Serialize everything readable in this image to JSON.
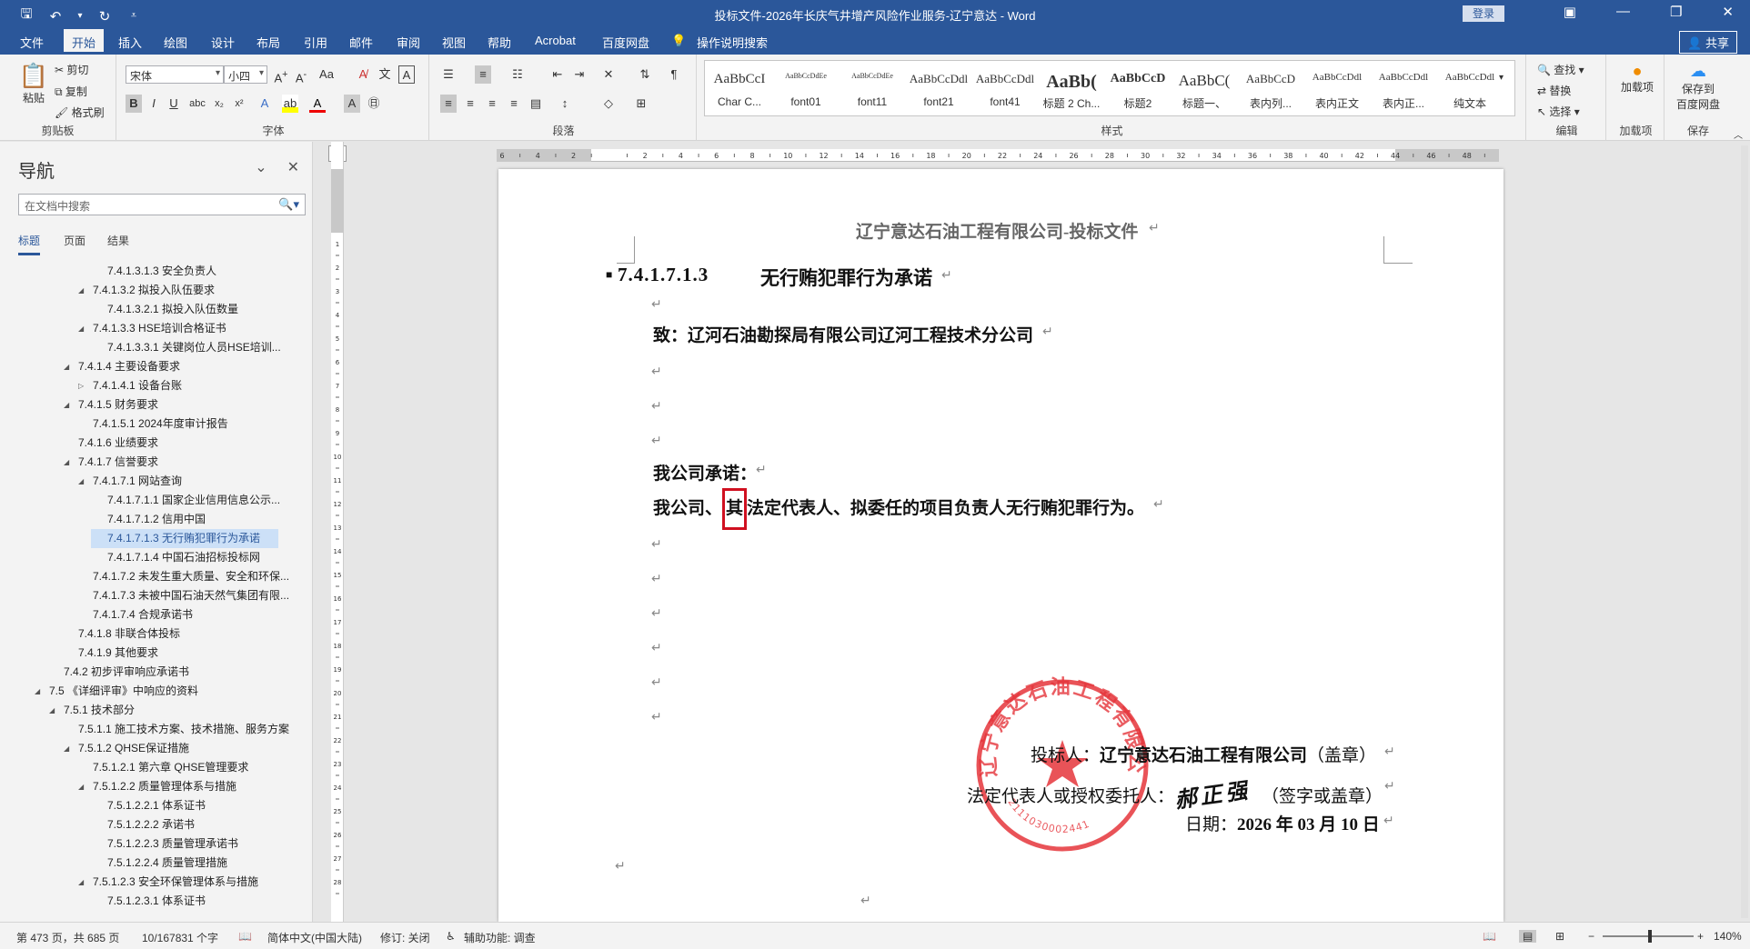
{
  "titlebar": {
    "title": "投标文件-2026年长庆气井增产风险作业服务-辽宁意达 - Word",
    "login": "登录",
    "save_icon": "save-icon",
    "undo_icon": "undo-icon",
    "redo_icon": "redo-icon"
  },
  "tabs": {
    "file": "文件",
    "home": "开始",
    "insert": "插入",
    "draw": "绘图",
    "design": "设计",
    "layout": "布局",
    "references": "引用",
    "mailings": "邮件",
    "review": "审阅",
    "view": "视图",
    "help": "帮助",
    "acrobat": "Acrobat",
    "baidu": "百度网盘",
    "tellme": "操作说明搜索",
    "share": "共享"
  },
  "ribbon": {
    "clipboard": {
      "paste": "粘贴",
      "cut": "剪切",
      "copy": "复制",
      "format_painter": "格式刷",
      "label": "剪贴板"
    },
    "font": {
      "name": "宋体",
      "size": "小四",
      "label": "字体"
    },
    "paragraph": {
      "label": "段落"
    },
    "styles": {
      "label": "样式",
      "items": [
        {
          "sample": "AaBbCcI",
          "name": "Char C..."
        },
        {
          "sample": "AaBbCcDdEe",
          "name": "font01"
        },
        {
          "sample": "AaBbCcDdEe",
          "name": "font11"
        },
        {
          "sample": "AaBbCcDdl",
          "name": "font21"
        },
        {
          "sample": "AaBbCcDdl",
          "name": "font41"
        },
        {
          "sample": "AaBb(",
          "name": "标题 2 Ch..."
        },
        {
          "sample": "AaBbCcD",
          "name": "标题2"
        },
        {
          "sample": "AaBbC(",
          "name": "标题一、"
        },
        {
          "sample": "AaBbCcD",
          "name": "表内列..."
        },
        {
          "sample": "AaBbCcDdl",
          "name": "表内正文"
        },
        {
          "sample": "AaBbCcDdl",
          "name": "表内正..."
        },
        {
          "sample": "AaBbCcDdl",
          "name": "纯文本"
        }
      ]
    },
    "editing": {
      "find": "查找",
      "replace": "替换",
      "select": "选择",
      "label": "编辑"
    },
    "addins": {
      "add": "加载项",
      "label": "加载项"
    },
    "save_baidu": {
      "label1": "保存到",
      "label2": "百度网盘",
      "label": "保存"
    }
  },
  "nav": {
    "title": "导航",
    "search_placeholder": "在文档中搜索",
    "tabs": [
      "标题",
      "页面",
      "结果"
    ],
    "items": [
      {
        "text": "7.4.1.3.1.3 安全负责人",
        "level": 4,
        "arrow": ""
      },
      {
        "text": "7.4.1.3.2 拟投入队伍要求",
        "level": 3,
        "arrow": "◢"
      },
      {
        "text": "7.4.1.3.2.1 拟投入队伍数量",
        "level": 4,
        "arrow": ""
      },
      {
        "text": "7.4.1.3.3 HSE培训合格证书",
        "level": 3,
        "arrow": "◢"
      },
      {
        "text": "7.4.1.3.3.1 关键岗位人员HSE培训...",
        "level": 4,
        "arrow": ""
      },
      {
        "text": "7.4.1.4 主要设备要求",
        "level": 2,
        "arrow": "◢"
      },
      {
        "text": "7.4.1.4.1 设备台账",
        "level": 3,
        "arrow": "▷"
      },
      {
        "text": "7.4.1.5 财务要求",
        "level": 2,
        "arrow": "◢"
      },
      {
        "text": "7.4.1.5.1 2024年度审计报告",
        "level": 3,
        "arrow": ""
      },
      {
        "text": "7.4.1.6 业绩要求",
        "level": 2,
        "arrow": ""
      },
      {
        "text": "7.4.1.7 信誉要求",
        "level": 2,
        "arrow": "◢"
      },
      {
        "text": "7.4.1.7.1 网站查询",
        "level": 3,
        "arrow": "◢"
      },
      {
        "text": "7.4.1.7.1.1 国家企业信用信息公示...",
        "level": 4,
        "arrow": ""
      },
      {
        "text": "7.4.1.7.1.2 信用中国",
        "level": 4,
        "arrow": ""
      },
      {
        "text": "7.4.1.7.1.3 无行贿犯罪行为承诺",
        "level": 4,
        "arrow": "",
        "selected": true
      },
      {
        "text": "7.4.1.7.1.4 中国石油招标投标网",
        "level": 4,
        "arrow": ""
      },
      {
        "text": "7.4.1.7.2 未发生重大质量、安全和环保...",
        "level": 3,
        "arrow": ""
      },
      {
        "text": "7.4.1.7.3 未被中国石油天然气集团有限...",
        "level": 3,
        "arrow": ""
      },
      {
        "text": "7.4.1.7.4 合规承诺书",
        "level": 3,
        "arrow": ""
      },
      {
        "text": "7.4.1.8 非联合体投标",
        "level": 2,
        "arrow": ""
      },
      {
        "text": "7.4.1.9 其他要求",
        "level": 2,
        "arrow": ""
      },
      {
        "text": "7.4.2 初步评审响应承诺书",
        "level": 1,
        "arrow": ""
      },
      {
        "text": "7.5 《详细评审》中响应的资料",
        "level": 0,
        "arrow": "◢"
      },
      {
        "text": "7.5.1 技术部分",
        "level": 1,
        "arrow": "◢"
      },
      {
        "text": "7.5.1.1 施工技术方案、技术措施、服务方案",
        "level": 2,
        "arrow": ""
      },
      {
        "text": "7.5.1.2 QHSE保证措施",
        "level": 2,
        "arrow": "◢"
      },
      {
        "text": "7.5.1.2.1 第六章 QHSE管理要求",
        "level": 3,
        "arrow": ""
      },
      {
        "text": "7.5.1.2.2 质量管理体系与措施",
        "level": 3,
        "arrow": "◢"
      },
      {
        "text": "7.5.1.2.2.1 体系证书",
        "level": 4,
        "arrow": ""
      },
      {
        "text": "7.5.1.2.2.2 承诺书",
        "level": 4,
        "arrow": ""
      },
      {
        "text": "7.5.1.2.2.3 质量管理承诺书",
        "level": 4,
        "arrow": ""
      },
      {
        "text": "7.5.1.2.2.4 质量管理措施",
        "level": 4,
        "arrow": ""
      },
      {
        "text": "7.5.1.2.3 安全环保管理体系与措施",
        "level": 3,
        "arrow": "◢"
      },
      {
        "text": "7.5.1.2.3.1 体系证书",
        "level": 4,
        "arrow": ""
      }
    ]
  },
  "ruler_labels": [
    "6",
    "4",
    "2",
    "",
    "2",
    "4",
    "6",
    "8",
    "10",
    "12",
    "14",
    "16",
    "18",
    "20",
    "22",
    "24",
    "26",
    "28",
    "30",
    "32",
    "34",
    "36",
    "38",
    "40",
    "42",
    "44",
    "46",
    "48"
  ],
  "vruler_labels": [
    "1",
    "2",
    "3",
    "4",
    "5",
    "6",
    "7",
    "8",
    "9",
    "10",
    "11",
    "12",
    "13",
    "14",
    "15",
    "16",
    "17",
    "18",
    "19",
    "20",
    "21",
    "22",
    "23",
    "24",
    "25",
    "26",
    "27",
    "28"
  ],
  "document": {
    "header": "辽宁意达石油工程有限公司-投标文件",
    "heading_number": "7.4.1.7.1.3",
    "heading_text": "无行贿犯罪行为承诺",
    "to_line": "致：辽河石油勘探局有限公司辽河工程技术分公司",
    "promise_title": "我公司承诺：",
    "promise_body_1": "我公司、",
    "promise_body_boxed": "其",
    "promise_body_2": "法定代表人、拟委任的项目负责人无行贿犯罪行为。",
    "bidder_label": "投标人：",
    "bidder_name": "辽宁意达石油工程有限公司",
    "bidder_seal": "（盖章）",
    "rep_label": "法定代表人或授权委托人：",
    "rep_sign": "（签字或盖章）",
    "date_label": "日期：",
    "date_value": "2026 年 03 月 10 日",
    "stamp_text": "辽宁意达石油工程有限公司",
    "stamp_code": "2111030002441",
    "signature": "郝正强",
    "stamp_color": "#e5353b",
    "paragraph_mark": "↵"
  },
  "status": {
    "page": "第 473 页，共 685 页",
    "words": "10/167831 个字",
    "lang": "简体中文(中国大陆)",
    "track": "修订: 关闭",
    "access": "辅助功能: 调查",
    "zoom": "140%"
  }
}
